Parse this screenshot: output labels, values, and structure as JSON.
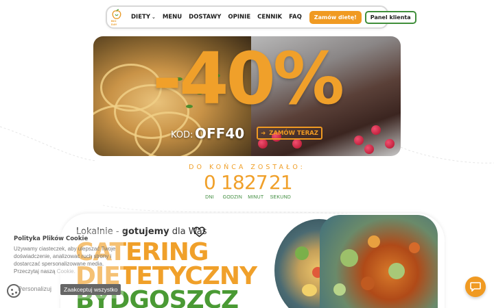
{
  "brand": {
    "logo_text": "BIO DAY",
    "accent": "#f09a22",
    "green": "#3f8e3a"
  },
  "nav": {
    "items": [
      {
        "label": "DIETY",
        "has_dropdown": true
      },
      {
        "label": "MENU"
      },
      {
        "label": "DOSTAWY"
      },
      {
        "label": "OPINIE"
      },
      {
        "label": "CENNIK"
      },
      {
        "label": "FAQ"
      }
    ],
    "order_button": "Zamów dietę!",
    "panel_button": "Panel klienta"
  },
  "hero": {
    "discount": "-40%",
    "code_label": "KOD:",
    "code_value": "OFF40",
    "cta_label": "ZAMÓW TERAZ",
    "cta_icon": "arrow-right-icon"
  },
  "countdown": {
    "title": "DO KOŃCA ZOSTAŁO:",
    "days": {
      "value": "0",
      "label": "DNI"
    },
    "hours": {
      "value": "18",
      "label": "GODZIN"
    },
    "minutes": {
      "value": "27",
      "label": "MINUT"
    },
    "seconds": {
      "value": "21",
      "label": "SEKUND"
    }
  },
  "section": {
    "tagline_prefix": "Lokalnie - ",
    "tagline_bold": "gotujemy",
    "tagline_suffix": " dla Was",
    "heading_line1": "CATERING",
    "heading_line2": "DIETETYCZNY",
    "heading_line3": "BYDGOSZCZ",
    "heart_icon": "heart-icon"
  },
  "cookie": {
    "title": "Polityka Plików Cookie",
    "text": "Używamy ciasteczek, aby ulepszać Twoje doświadczenie, analizować ruch strony i dostarczać spersonalizowane media. Przeczytaj naszą",
    "text_faded": "Cookie.",
    "personalize_label": "Personalizuj",
    "accept_label": "Zaakceptuj wszystko"
  },
  "chat": {
    "icon": "chat-bubble-icon"
  }
}
